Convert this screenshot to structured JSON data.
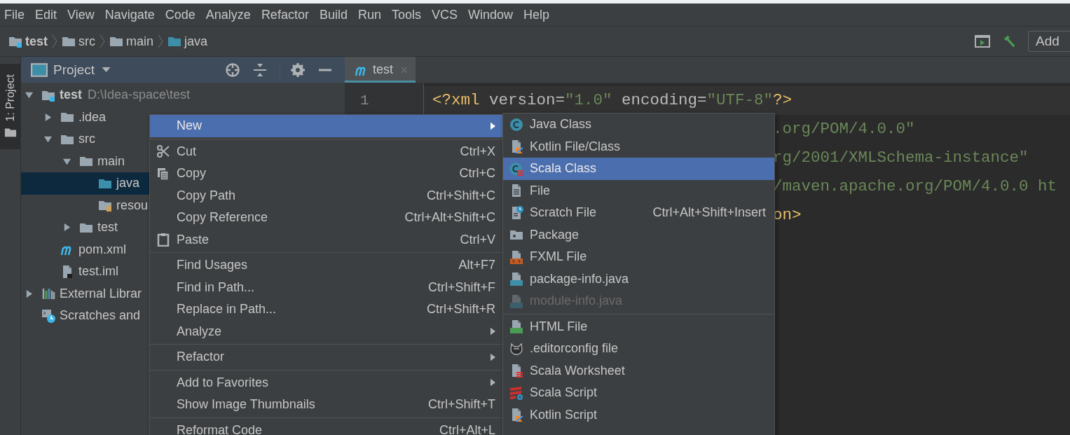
{
  "menu_bar": [
    "File",
    "Edit",
    "View",
    "Navigate",
    "Code",
    "Analyze",
    "Refactor",
    "Build",
    "Run",
    "Tools",
    "VCS",
    "Window",
    "Help"
  ],
  "breadcrumbs": [
    {
      "label": "test",
      "kind": "module"
    },
    {
      "label": "src",
      "kind": "folder"
    },
    {
      "label": "main",
      "kind": "folder"
    },
    {
      "label": "java",
      "kind": "source"
    }
  ],
  "toolbar": {
    "config_button": "Add"
  },
  "side_stripe": {
    "label": "1: Project",
    "selected": true
  },
  "project_panel": {
    "title": "Project",
    "tree": [
      {
        "label": "test",
        "path": "D:\\Idea-space\\test",
        "kind": "module",
        "expanded": true,
        "selected": false,
        "children": [
          {
            "label": ".idea",
            "kind": "folder",
            "expanded": false,
            "selected": false
          },
          {
            "label": "src",
            "kind": "folder",
            "expanded": true,
            "selected": false,
            "children": [
              {
                "label": "main",
                "kind": "folder",
                "expanded": true,
                "selected": false,
                "children": [
                  {
                    "label": "java",
                    "kind": "source",
                    "selected": true
                  },
                  {
                    "label": "resou",
                    "kind": "resources",
                    "selected": false
                  }
                ]
              },
              {
                "label": "test",
                "kind": "folder",
                "expanded": false,
                "selected": false
              }
            ]
          },
          {
            "label": "pom.xml",
            "kind": "maven",
            "selected": false
          },
          {
            "label": "test.iml",
            "kind": "iml",
            "selected": false
          }
        ]
      },
      {
        "label": "External Librar",
        "kind": "libraries",
        "expanded": false,
        "selected": false
      },
      {
        "label": "Scratches and",
        "kind": "scratches",
        "selected": false
      }
    ]
  },
  "editor": {
    "tabs": [
      {
        "label": "test",
        "selected": true
      }
    ],
    "line_numbers": [
      "1"
    ],
    "lines": [
      {
        "kind": "full",
        "segments": [
          {
            "text": "<?xml",
            "kind": "tag"
          },
          {
            "text": " version=",
            "kind": "attr"
          },
          {
            "text": "\"1.0\"",
            "kind": "value"
          },
          {
            "text": " encoding=",
            "kind": "attr"
          },
          {
            "text": "\"UTF-8\"",
            "kind": "value"
          },
          {
            "text": "?>",
            "kind": "tag"
          }
        ]
      },
      {
        "kind": "tail",
        "segments": [
          {
            "text": ".org/POM/4.0.0\"",
            "kind": "value"
          }
        ]
      },
      {
        "kind": "tail",
        "segments": [
          {
            "text": "rg/2001/XMLSchema-instance\"",
            "kind": "value"
          }
        ]
      },
      {
        "kind": "tail",
        "segments": [
          {
            "text": "/maven.apache.org/POM/4.0.0 ht",
            "kind": "value"
          }
        ]
      },
      {
        "kind": "tail",
        "segments": [
          {
            "text": "on>",
            "kind": "tag"
          }
        ]
      }
    ]
  },
  "context_menu": {
    "items": [
      {
        "kind": "item",
        "label": "New",
        "submenu": true,
        "selected": true
      },
      {
        "kind": "separator"
      },
      {
        "kind": "cut",
        "label": "Cut",
        "shortcut": "Ctrl+X",
        "selected": false
      },
      {
        "kind": "copy",
        "label": "Copy",
        "shortcut": "Ctrl+C",
        "selected": false
      },
      {
        "kind": "item",
        "label": "Copy Path",
        "shortcut": "Ctrl+Shift+C",
        "selected": false
      },
      {
        "kind": "item",
        "label": "Copy Reference",
        "shortcut": "Ctrl+Alt+Shift+C",
        "selected": false
      },
      {
        "kind": "paste",
        "label": "Paste",
        "shortcut": "Ctrl+V",
        "selected": false
      },
      {
        "kind": "separator"
      },
      {
        "kind": "item",
        "label": "Find Usages",
        "shortcut": "Alt+F7",
        "selected": false
      },
      {
        "kind": "item",
        "label": "Find in Path...",
        "shortcut": "Ctrl+Shift+F",
        "selected": false
      },
      {
        "kind": "item",
        "label": "Replace in Path...",
        "shortcut": "Ctrl+Shift+R",
        "selected": false
      },
      {
        "kind": "item",
        "label": "Analyze",
        "submenu": true,
        "selected": false
      },
      {
        "kind": "separator"
      },
      {
        "kind": "item",
        "label": "Refactor",
        "submenu": true,
        "selected": false
      },
      {
        "kind": "separator"
      },
      {
        "kind": "item",
        "label": "Add to Favorites",
        "submenu": true,
        "selected": false
      },
      {
        "kind": "item",
        "label": "Show Image Thumbnails",
        "shortcut": "Ctrl+Shift+T",
        "selected": false
      },
      {
        "kind": "separator"
      },
      {
        "kind": "item",
        "label": "Reformat Code",
        "shortcut": "Ctrl+Alt+L",
        "selected": false
      }
    ]
  },
  "new_submenu": {
    "items": [
      {
        "kind": "java-class",
        "label": "Java Class",
        "selected": false,
        "disabled": false
      },
      {
        "kind": "kotlin",
        "label": "Kotlin File/Class",
        "selected": false,
        "disabled": false
      },
      {
        "kind": "scala-class",
        "label": "Scala Class",
        "selected": true,
        "disabled": false
      },
      {
        "kind": "file",
        "label": "File",
        "selected": false,
        "disabled": false
      },
      {
        "kind": "scratch",
        "label": "Scratch File",
        "shortcut": "Ctrl+Alt+Shift+Insert",
        "selected": false,
        "disabled": false
      },
      {
        "kind": "package",
        "label": "Package",
        "selected": false,
        "disabled": false
      },
      {
        "kind": "fxml",
        "label": "FXML File",
        "selected": false,
        "disabled": false
      },
      {
        "kind": "java-file",
        "label": "package-info.java",
        "selected": false,
        "disabled": false
      },
      {
        "kind": "java-file",
        "label": "module-info.java",
        "selected": false,
        "disabled": true
      },
      {
        "kind": "separator"
      },
      {
        "kind": "html",
        "label": "HTML File",
        "selected": false,
        "disabled": false
      },
      {
        "kind": "editorconfig",
        "label": ".editorconfig file",
        "selected": false,
        "disabled": false
      },
      {
        "kind": "scala-worksheet",
        "label": "Scala Worksheet",
        "selected": false,
        "disabled": false
      },
      {
        "kind": "scala-script",
        "label": "Scala Script",
        "selected": false,
        "disabled": false
      },
      {
        "kind": "kotlin",
        "label": "Kotlin Script",
        "selected": false,
        "disabled": false
      }
    ]
  }
}
